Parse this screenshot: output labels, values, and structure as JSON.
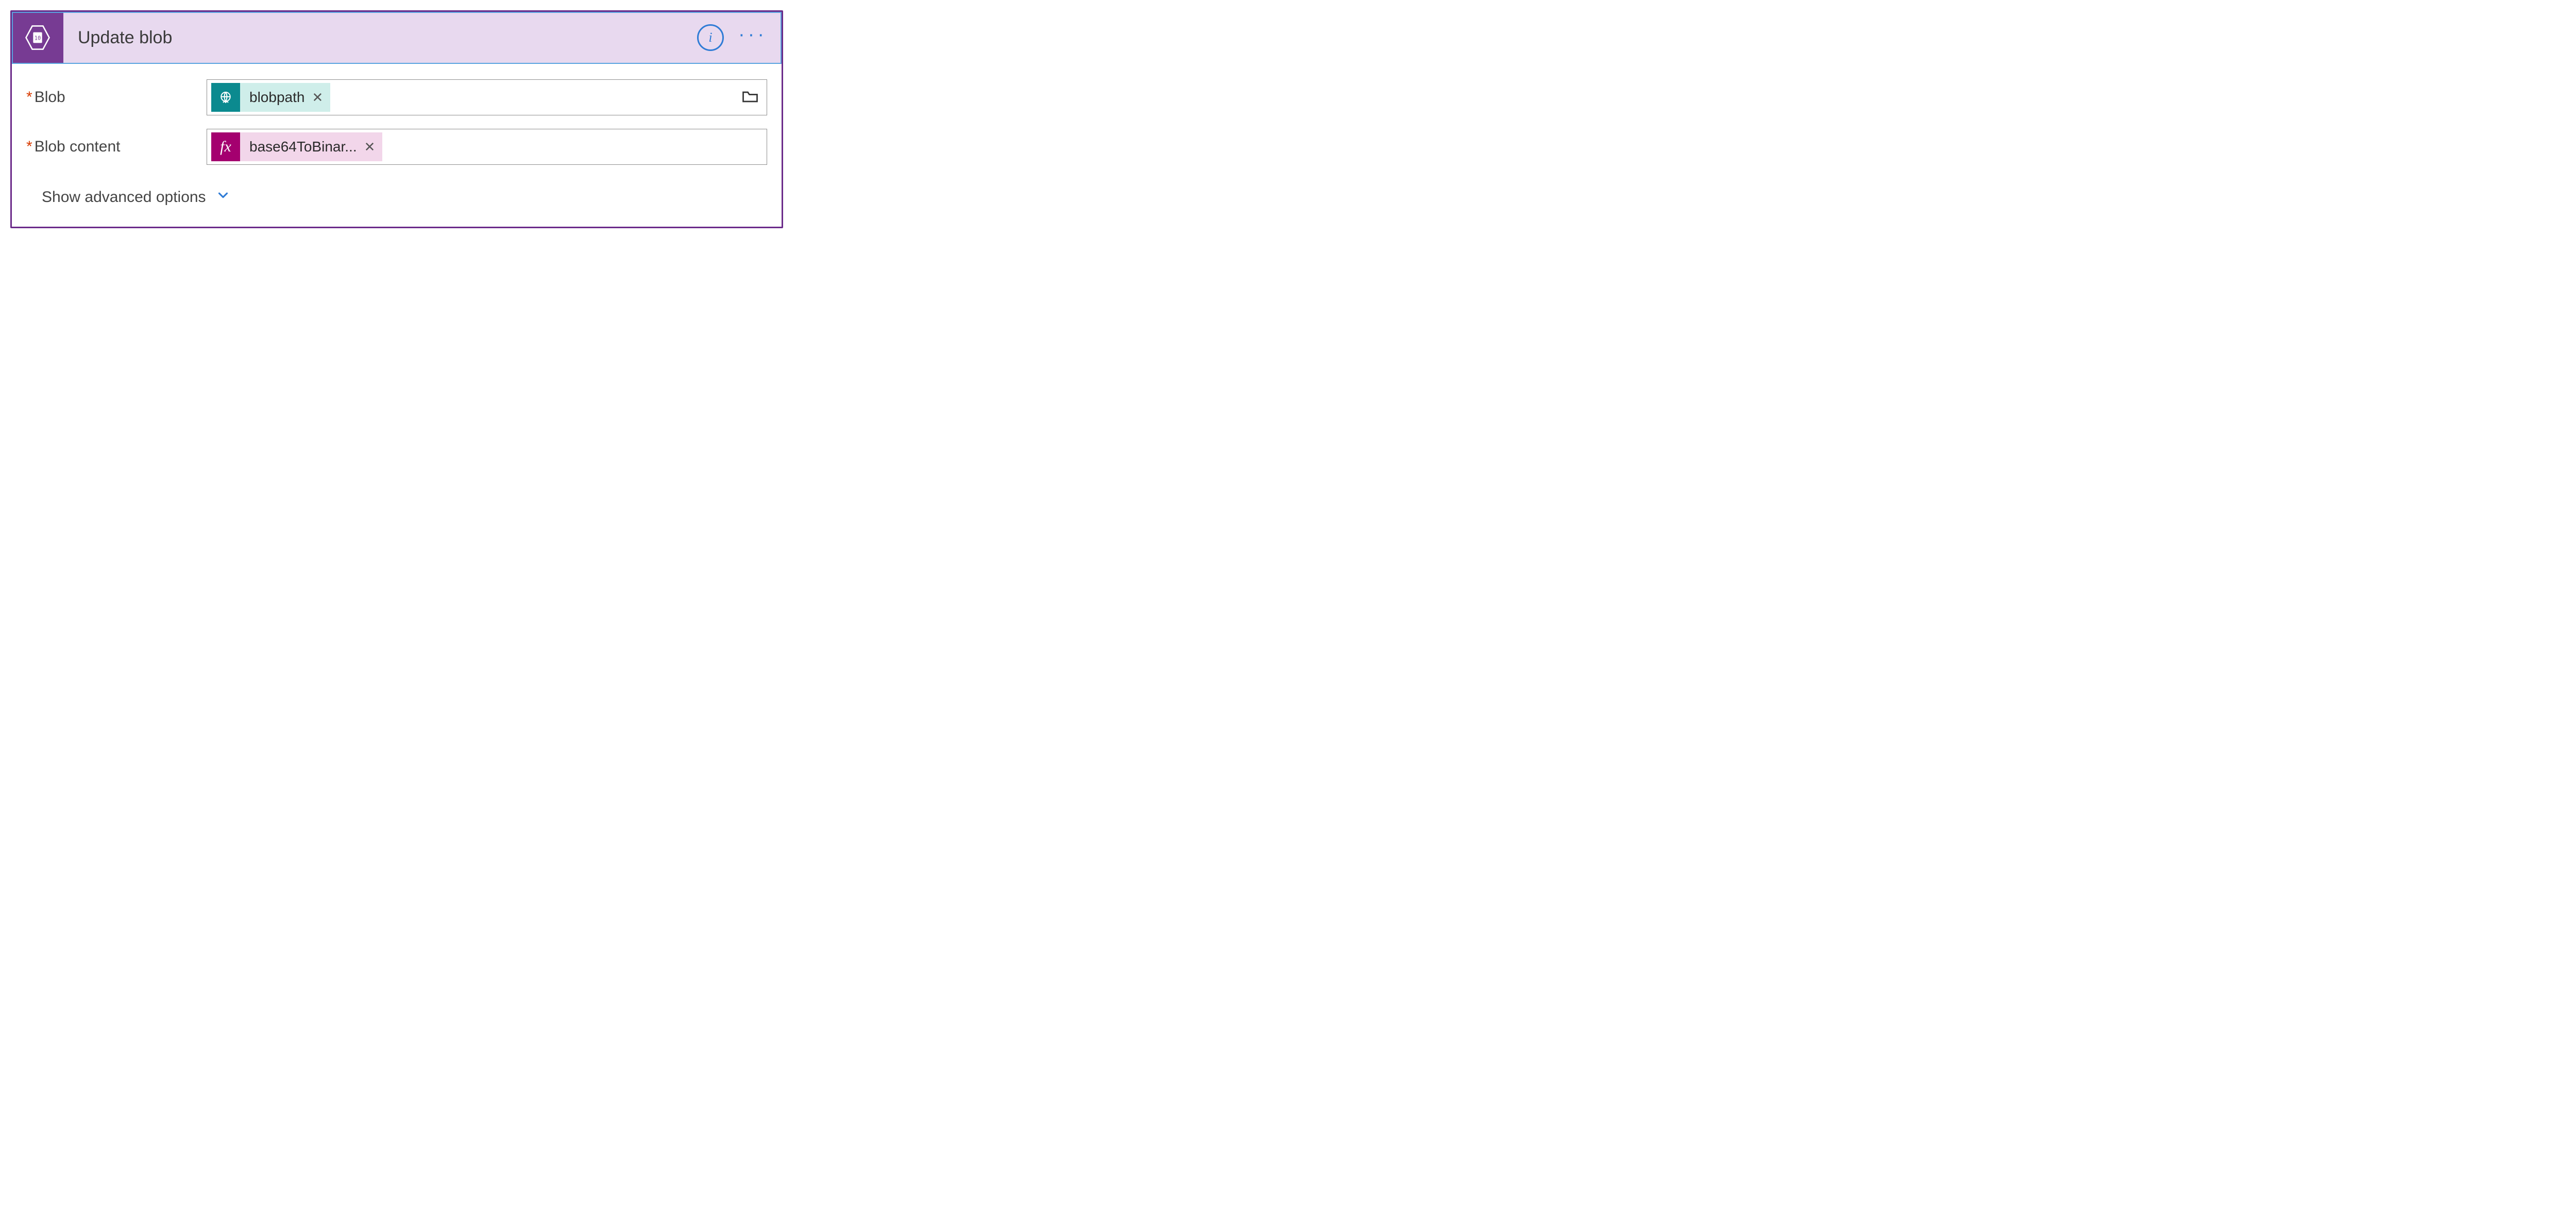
{
  "header": {
    "title": "Update blob"
  },
  "fields": {
    "blob": {
      "label": "Blob",
      "token": "blobpath"
    },
    "blobContent": {
      "label": "Blob content",
      "token": "base64ToBinar..."
    }
  },
  "advanced": {
    "label": "Show advanced options"
  },
  "icons": {
    "fx": "fx",
    "info": "i",
    "ellipsis": "···"
  }
}
